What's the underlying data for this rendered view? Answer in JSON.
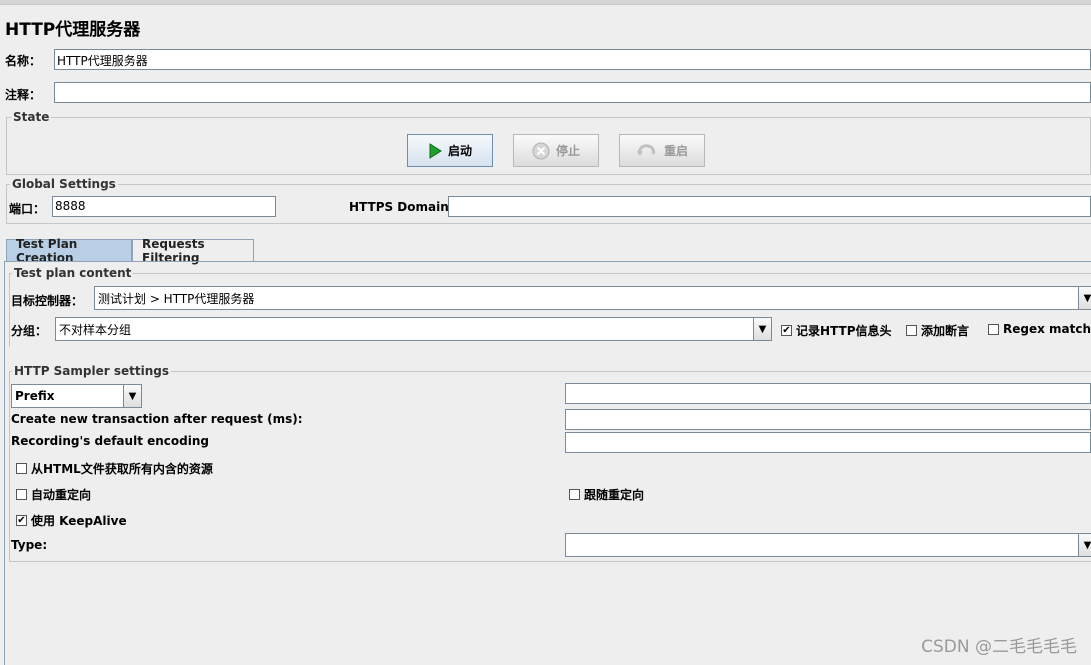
{
  "window": {
    "title": "HTTP代理服务器"
  },
  "fields": {
    "name_label": "名称：",
    "name_value": "HTTP代理服务器",
    "comment_label": "注释：",
    "comment_value": ""
  },
  "state": {
    "legend": "State",
    "start_label": "启动",
    "stop_label": "停止",
    "restart_label": "重启"
  },
  "global": {
    "legend": "Global Settings",
    "port_label": "端口：",
    "port_value": "8888",
    "https_label": "HTTPS Domains:",
    "https_value": ""
  },
  "tabs": [
    {
      "label": "Test Plan Creation",
      "active": true
    },
    {
      "label": "Requests Filtering",
      "active": false
    }
  ],
  "test_plan": {
    "legend": "Test plan content",
    "target_label": "目标控制器：",
    "target_value": "测试计划 > HTTP代理服务器",
    "group_label": "分组：",
    "group_value": "不对样本分组",
    "record_http_label": "记录HTTP信息头",
    "record_http_checked": true,
    "add_assert_label": "添加断言",
    "add_assert_checked": false,
    "regex_label": "Regex matching",
    "regex_checked": false
  },
  "sampler": {
    "legend": "HTTP Sampler settings",
    "prefix_value": "Prefix",
    "transaction_label": "Create new transaction after request (ms):",
    "encoding_label": "Recording's default encoding",
    "fetch_resources_label": "从HTML文件获取所有内含的资源",
    "fetch_resources_checked": false,
    "auto_redirect_label": "自动重定向",
    "auto_redirect_checked": false,
    "follow_redirect_label": "跟随重定向",
    "follow_redirect_checked": false,
    "keepalive_label": "使用 KeepAlive",
    "keepalive_checked": true,
    "type_label": "Type:",
    "type_value": ""
  },
  "watermark": "CSDN @二毛毛毛毛",
  "colors": {
    "tab_active": "#b8cfe5",
    "start_icon": "#1e9e2a",
    "background": "#eeeeee"
  }
}
